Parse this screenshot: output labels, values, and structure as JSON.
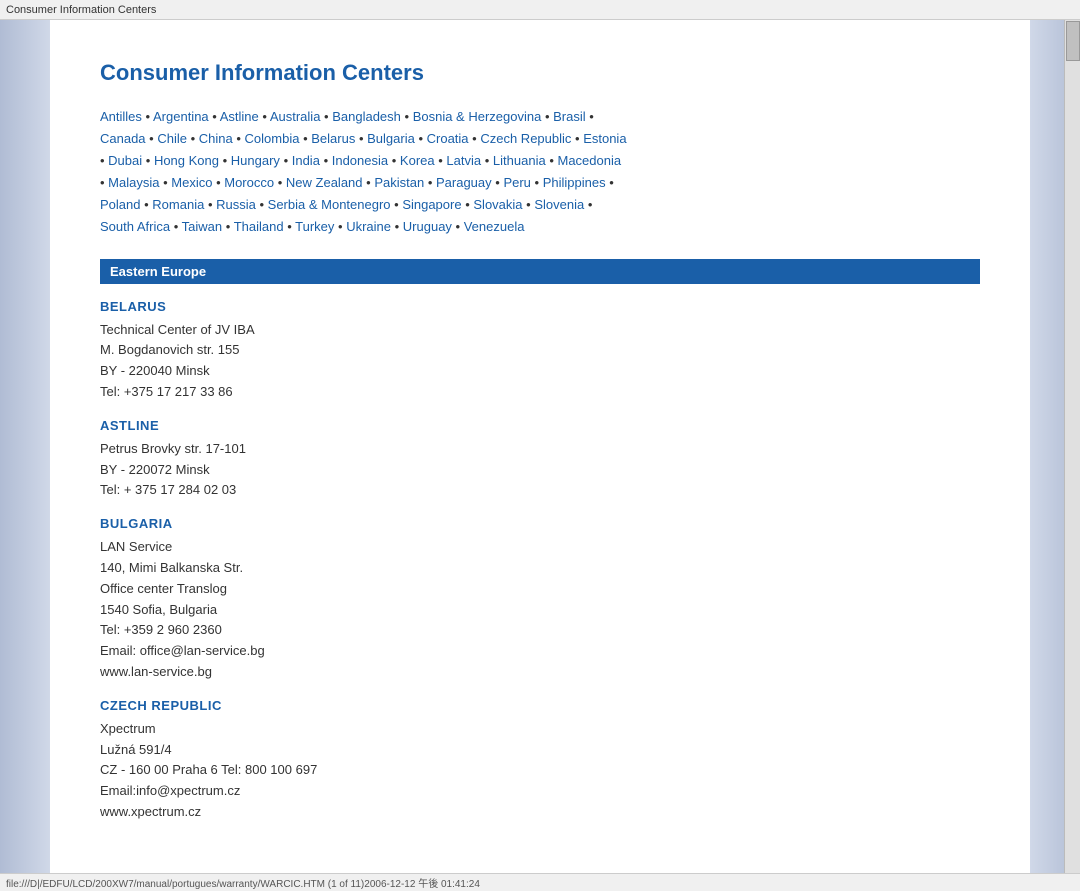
{
  "titleBar": {
    "text": "Consumer Information Centers"
  },
  "page": {
    "title": "Consumer Information Centers"
  },
  "links": {
    "items": [
      "Antilles",
      "Argentina",
      "Astline",
      "Australia",
      "Bangladesh",
      "Bosnia & Herzegovina",
      "Brasil",
      "Canada",
      "Chile",
      "China",
      "Colombia",
      "Belarus",
      "Bulgaria",
      "Croatia",
      "Czech Republic",
      "Estonia",
      "Dubai",
      "Hong Kong",
      "Hungary",
      "India",
      "Indonesia",
      "Korea",
      "Latvia",
      "Lithuania",
      "Macedonia",
      "Malaysia",
      "Mexico",
      "Morocco",
      "New Zealand",
      "Pakistan",
      "Paraguay",
      "Peru",
      "Philippines",
      "Poland",
      "Romania",
      "Russia",
      "Serbia & Montenegro",
      "Singapore",
      "Slovakia",
      "Slovenia",
      "South Africa",
      "Taiwan",
      "Thailand",
      "Turkey",
      "Ukraine",
      "Uruguay",
      "Venezuela"
    ],
    "line1": "Antilles • Argentina • Astline • Australia • Bangladesh • Bosnia & Herzegovina• Brasil •",
    "line2": "Canada • Chile • China • Colombia • Belarus • Bulgaria • Croatia • Czech Republic • Estonia",
    "line3": "• Dubai •  Hong Kong • Hungary • India • Indonesia • Korea • Latvia • Lithuania • Macedonia",
    "line4": "• Malaysia • Mexico • Morocco • New Zealand • Pakistan • Paraguay • Peru • Philippines •",
    "line5": "Poland • Romania • Russia • Serbia & Montenegro • Singapore • Slovakia • Slovenia •",
    "line6": "South Africa • Taiwan • Thailand • Turkey • Ukraine • Uruguay • Venezuela"
  },
  "sections": {
    "easternEurope": {
      "header": "Eastern Europe",
      "countries": [
        {
          "id": "belarus",
          "title": "BELARUS",
          "lines": [
            "Technical Center of JV IBA",
            "M. Bogdanovich str. 155",
            "BY - 220040 Minsk",
            "Tel: +375 17 217 33 86"
          ]
        },
        {
          "id": "astline",
          "title": "ASTLINE",
          "lines": [
            "Petrus Brovky str. 17-101",
            "BY - 220072 Minsk",
            "Tel: + 375 17 284 02 03"
          ]
        },
        {
          "id": "bulgaria",
          "title": "BULGARIA",
          "lines": [
            "LAN Service",
            "140, Mimi Balkanska Str.",
            "Office center Translog",
            "1540 Sofia, Bulgaria",
            "Tel: +359 2 960 2360",
            "Email: office@lan-service.bg",
            "www.lan-service.bg"
          ]
        },
        {
          "id": "czech-republic",
          "title": "CZECH REPUBLIC",
          "lines": [
            "Xpectrum",
            "Lužná 591/4",
            "CZ - 160 00 Praha 6 Tel: 800 100 697",
            "Email:info@xpectrum.cz",
            "www.xpectrum.cz"
          ]
        }
      ]
    }
  },
  "statusBar": {
    "text": "file:///D|/EDFU/LCD/200XW7/manual/portugues/warranty/WARCIC.HTM (1 of 11)2006-12-12 午後 01:41:24"
  }
}
